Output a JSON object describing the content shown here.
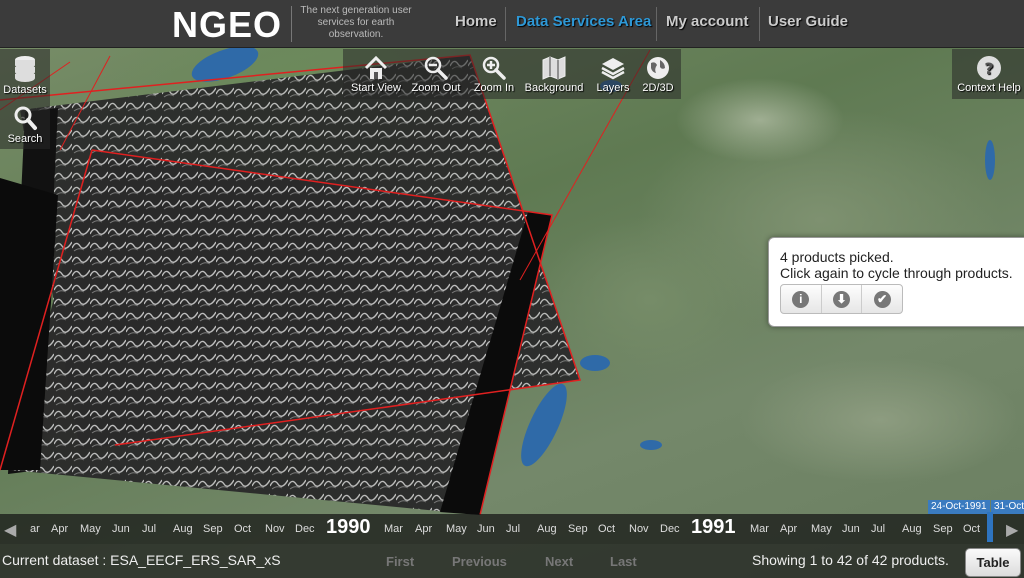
{
  "header": {
    "logo": "NGEO",
    "tagline": "The next generation user services for earth observation.",
    "nav": [
      {
        "label": "Home",
        "active": false
      },
      {
        "label": "Data Services Area",
        "active": true
      },
      {
        "label": "My account",
        "active": false
      },
      {
        "label": "User Guide",
        "active": false
      }
    ]
  },
  "left_toolbar": {
    "datasets_label": "Datasets",
    "search_label": "Search"
  },
  "map_toolbar": {
    "start_view": "Start View",
    "zoom_out": "Zoom Out",
    "zoom_in": "Zoom In",
    "background": "Background",
    "layers": "Layers",
    "toggle_3d": "2D/3D"
  },
  "help": {
    "context_help": "Context Help"
  },
  "popup": {
    "line1": "4 products picked.",
    "line2": "Click again to cycle through products.",
    "buttons": [
      {
        "icon": "info-icon",
        "glyph": "i"
      },
      {
        "icon": "download-icon",
        "glyph": "⬇"
      },
      {
        "icon": "check-icon",
        "glyph": "✔"
      }
    ]
  },
  "timeline": {
    "left_arrow": "◀",
    "right_arrow": "▶",
    "months_1990_pre": [
      "ar",
      "Apr",
      "May",
      "Jun",
      "Jul",
      "Aug",
      "Sep",
      "Oct",
      "Nov",
      "Dec"
    ],
    "year1": "1990",
    "months_1990": [
      "Mar",
      "Apr",
      "May",
      "Jun",
      "Jul",
      "Aug",
      "Sep",
      "Oct",
      "Nov",
      "Dec"
    ],
    "year2": "1991",
    "months_1991": [
      "Mar",
      "Apr",
      "May",
      "Jun",
      "Jul",
      "Aug",
      "Sep",
      "Oct"
    ],
    "range_start": "24-Oct-1991",
    "range_end": "31-Oct"
  },
  "status": {
    "current_dataset": "Current dataset : ESA_EECF_ERS_SAR_xS",
    "first": "First",
    "previous": "Previous",
    "next": "Next",
    "last": "Last",
    "showing": "Showing 1 to 42 of 42 products.",
    "table": "Table"
  },
  "colors": {
    "accent": "#2e98d6",
    "footprint_outline": "#e02020",
    "timeline_selection": "#3a7bc0"
  }
}
